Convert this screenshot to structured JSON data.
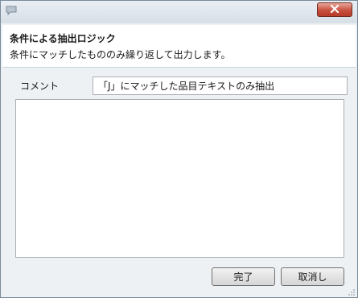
{
  "window": {
    "close_icon": "close-icon",
    "app_icon": "speech-bubble-icon"
  },
  "header": {
    "title": "条件による抽出ロジック",
    "description": "条件にマッチしたもののみ繰り返して出力します。"
  },
  "form": {
    "comment_label": "コメント",
    "comment_value": "「J」にマッチした品目テキストのみ抽出",
    "body_text": ""
  },
  "buttons": {
    "ok_label": "完了",
    "cancel_label": "取消し"
  },
  "colors": {
    "close_button": "#c9503e",
    "window_background": "#eef1f4"
  }
}
